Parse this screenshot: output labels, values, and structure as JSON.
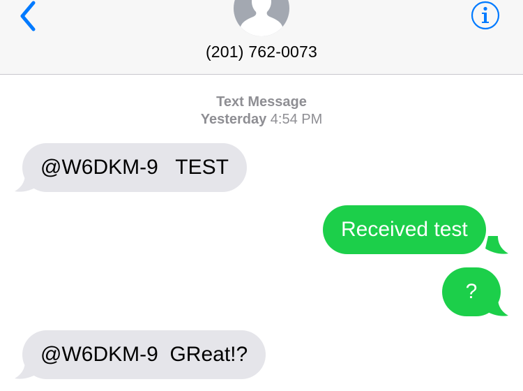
{
  "header": {
    "contact_number": "(201) 762-0073",
    "back_icon": "chevron-left-icon",
    "info_icon": "info-icon",
    "accent_color": "#007aff"
  },
  "thread": {
    "service_label": "Text Message",
    "timestamp_day": "Yesterday",
    "timestamp_time": "4:54 PM"
  },
  "messages": [
    {
      "direction": "incoming",
      "text": "@W6DKM-9   TEST"
    },
    {
      "direction": "outgoing",
      "text": "Received test"
    },
    {
      "direction": "outgoing",
      "text": "?"
    },
    {
      "direction": "incoming",
      "text": "@W6DKM-9  GReat!?"
    }
  ],
  "colors": {
    "incoming_bubble": "#e5e5ea",
    "outgoing_bubble": "#1ccf4a",
    "header_bg": "#f7f7f7",
    "meta_text": "#8e8e93"
  }
}
